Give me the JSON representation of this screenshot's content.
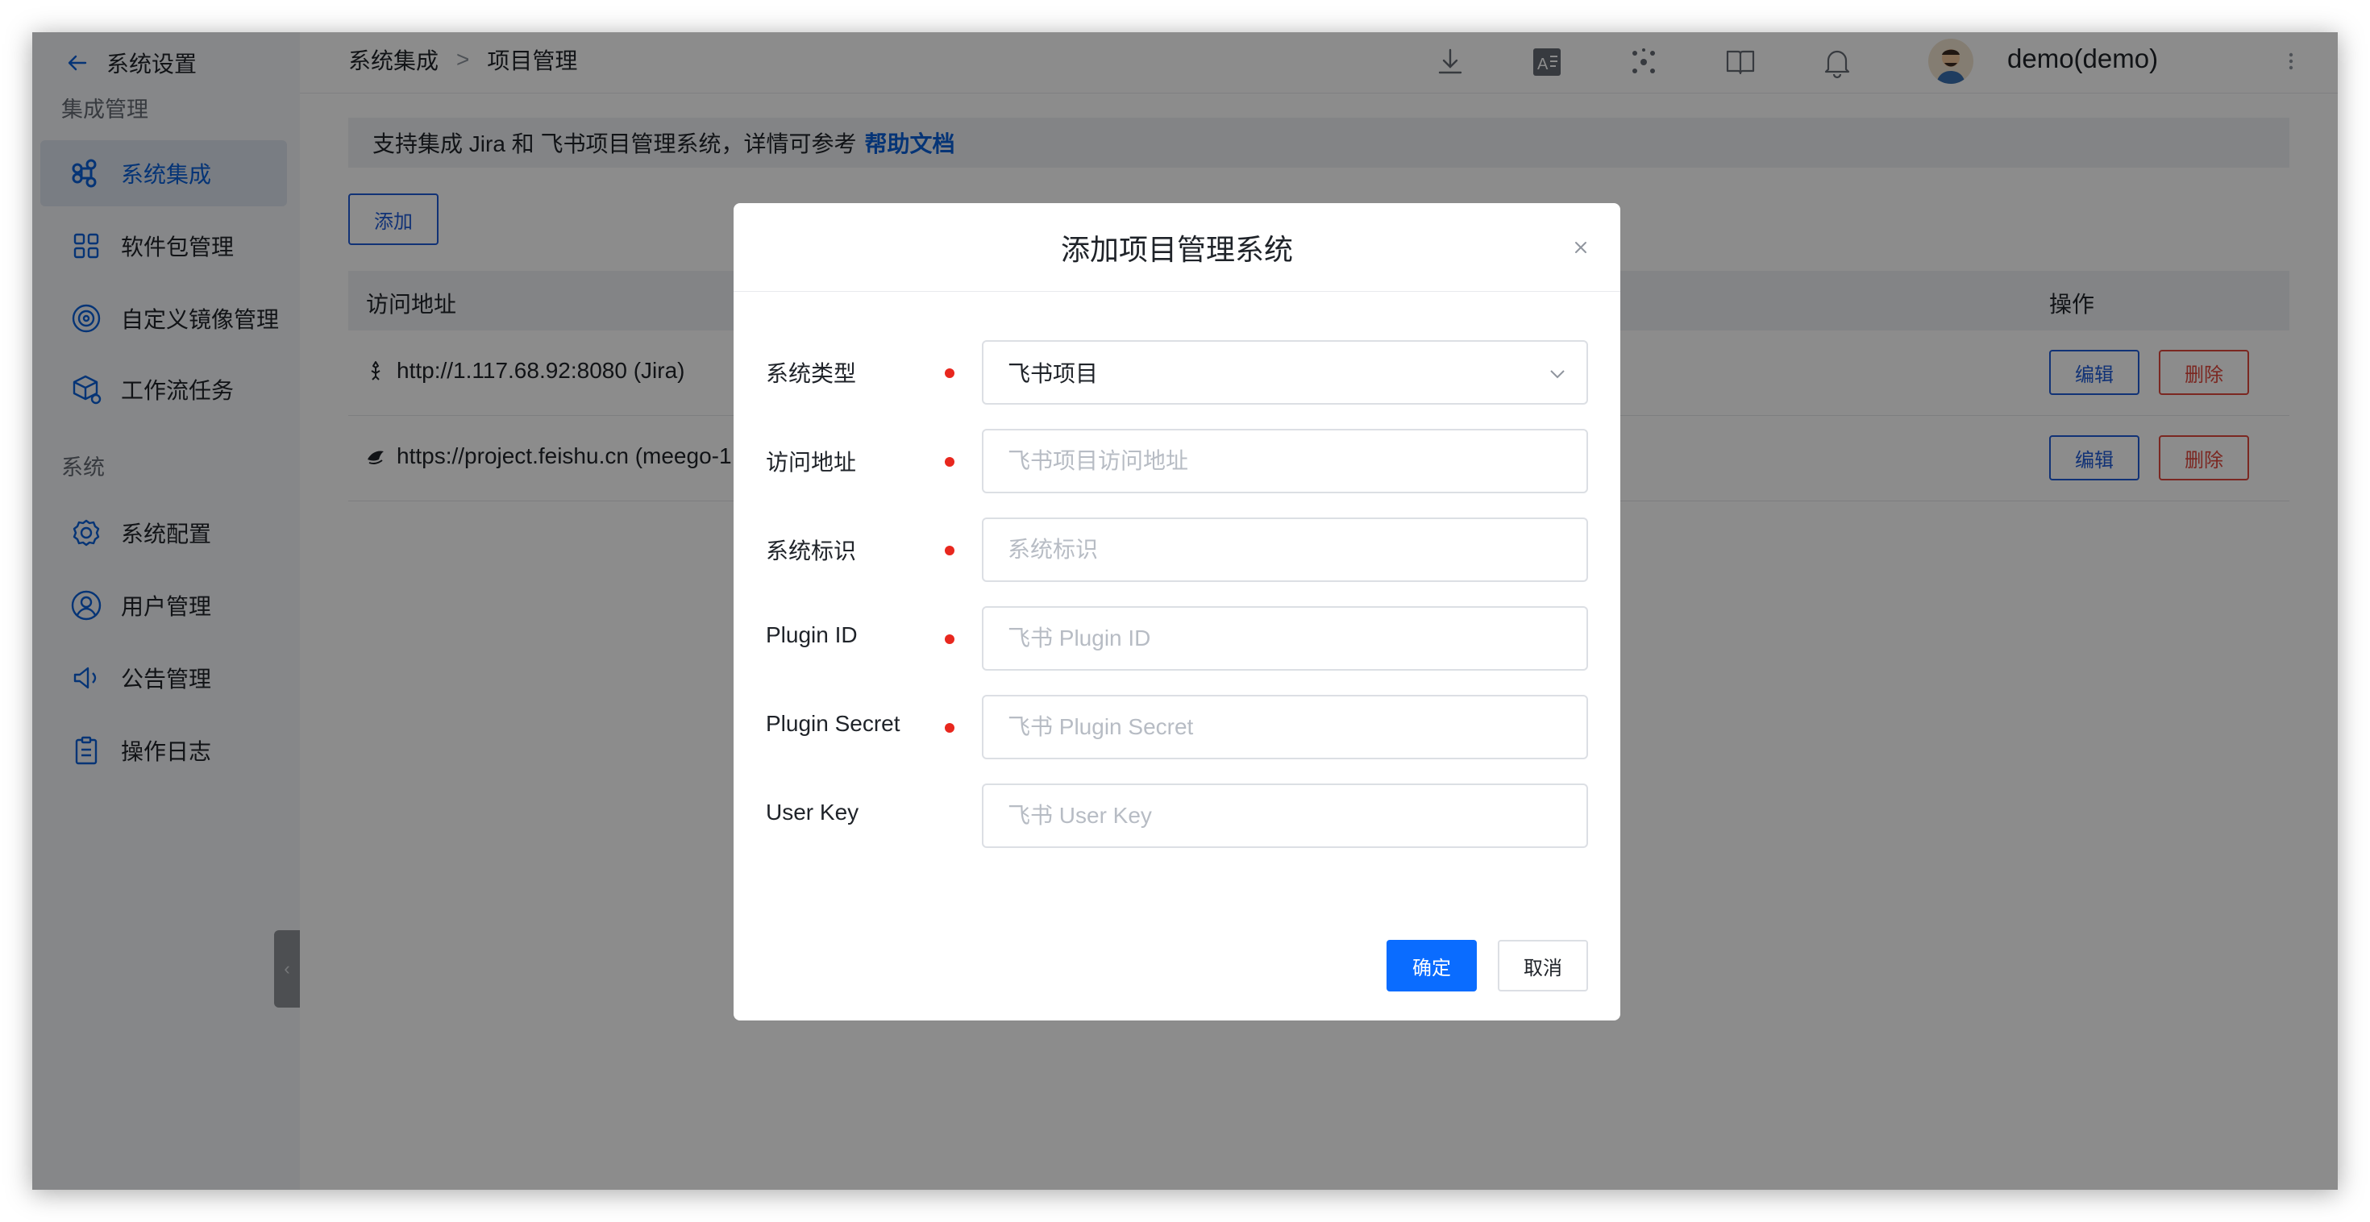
{
  "sidebar": {
    "back_label": "系统设置",
    "section_integration": "集成管理",
    "section_system": "系统",
    "items": [
      {
        "label": "系统集成",
        "icon": "command-icon",
        "active": true
      },
      {
        "label": "软件包管理",
        "icon": "grid-icon"
      },
      {
        "label": "自定义镜像管理",
        "icon": "disc-icon"
      },
      {
        "label": "工作流任务",
        "icon": "cube-gear-icon"
      },
      {
        "label": "系统配置",
        "icon": "settings-gear-icon"
      },
      {
        "label": "用户管理",
        "icon": "user-icon"
      },
      {
        "label": "公告管理",
        "icon": "speaker-icon"
      },
      {
        "label": "操作日志",
        "icon": "clipboard-icon"
      }
    ]
  },
  "header": {
    "breadcrumb": [
      "系统集成",
      ">",
      "项目管理"
    ],
    "username": "demo(demo)",
    "icons": [
      "download-icon",
      "translate-icon",
      "network-icon",
      "book-icon",
      "bell-icon"
    ]
  },
  "main": {
    "notice_text": "支持集成 Jira 和 飞书项目管理系统，详情可参考",
    "notice_link": "帮助文档",
    "add_label": "添加",
    "table": {
      "headers": [
        "访问地址",
        "操作"
      ],
      "rows": [
        {
          "address": "http://1.117.68.92:8080 (Jira)",
          "icon": "jira-icon"
        },
        {
          "address": "https://project.feishu.cn (meego-1",
          "icon": "feishu-icon"
        }
      ],
      "edit_label": "编辑",
      "delete_label": "删除"
    }
  },
  "modal": {
    "title": "添加项目管理系统",
    "fields": [
      {
        "label": "系统类型",
        "required": true,
        "value": "飞书项目",
        "placeholder": ""
      },
      {
        "label": "访问地址",
        "required": true,
        "value": "",
        "placeholder": "飞书项目访问地址"
      },
      {
        "label": "系统标识",
        "required": true,
        "value": "",
        "placeholder": "系统标识"
      },
      {
        "label": "Plugin ID",
        "required": true,
        "value": "",
        "placeholder": "飞书 Plugin ID"
      },
      {
        "label": "Plugin Secret",
        "required": true,
        "value": "",
        "placeholder": "飞书 Plugin Secret"
      },
      {
        "label": "User Key",
        "required": false,
        "value": "",
        "placeholder": "飞书 User Key"
      }
    ],
    "confirm_label": "确定",
    "cancel_label": "取消"
  },
  "colors": {
    "accent": "#0a5fd8",
    "primary_button": "#0a6cff",
    "danger": "#e0473d",
    "required_dot": "#e8271e",
    "overlay": "rgba(0,0,0,0.45)"
  }
}
